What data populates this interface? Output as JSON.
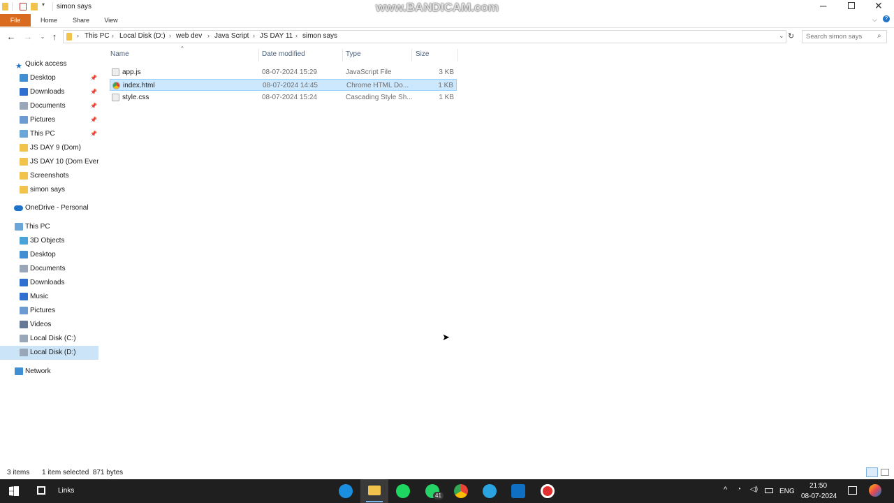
{
  "window": {
    "title": "simon says",
    "watermark": "www.BANDICAM.com"
  },
  "ribbon": {
    "tabs": [
      "File",
      "Home",
      "Share",
      "View"
    ]
  },
  "address_bar": {
    "breadcrumbs": [
      "This PC",
      "Local Disk (D:)",
      "web dev",
      "Java Script",
      "JS DAY 11",
      "simon says"
    ],
    "search_placeholder": "Search simon says"
  },
  "nav_pane": {
    "quick_access": "Quick access",
    "quick_items": [
      {
        "label": "Desktop",
        "icon": "desktop-icon"
      },
      {
        "label": "Downloads",
        "icon": "downloads-icon"
      },
      {
        "label": "Documents",
        "icon": "documents-icon"
      },
      {
        "label": "Pictures",
        "icon": "pictures-icon"
      },
      {
        "label": "This PC",
        "icon": "pc-icon"
      },
      {
        "label": "JS DAY 9 (Dom)",
        "icon": "folder-icon"
      },
      {
        "label": "JS DAY 10 (Dom Event",
        "icon": "folder-icon"
      },
      {
        "label": "Screenshots",
        "icon": "folder-icon"
      },
      {
        "label": "simon says",
        "icon": "folder-icon"
      }
    ],
    "onedrive": "OneDrive - Personal",
    "this_pc": "This PC",
    "pc_items": [
      {
        "label": "3D Objects",
        "icon": "3d-objects-icon"
      },
      {
        "label": "Desktop",
        "icon": "desktop-icon"
      },
      {
        "label": "Documents",
        "icon": "documents-icon"
      },
      {
        "label": "Downloads",
        "icon": "downloads-icon"
      },
      {
        "label": "Music",
        "icon": "music-icon"
      },
      {
        "label": "Pictures",
        "icon": "pictures-icon"
      },
      {
        "label": "Videos",
        "icon": "videos-icon"
      },
      {
        "label": "Local Disk (C:)",
        "icon": "drive-icon"
      },
      {
        "label": "Local Disk (D:)",
        "icon": "drive-icon"
      }
    ],
    "network": "Network"
  },
  "file_list": {
    "columns": [
      "Name",
      "Date modified",
      "Type",
      "Size"
    ],
    "rows": [
      {
        "name": "app.js",
        "date": "08-07-2024 15:29",
        "type": "JavaScript File",
        "size": "3 KB"
      },
      {
        "name": "index.html",
        "date": "08-07-2024 14:45",
        "type": "Chrome HTML Do...",
        "size": "1 KB"
      },
      {
        "name": "style.css",
        "date": "08-07-2024 15:24",
        "type": "Cascading Style Sh...",
        "size": "1 KB"
      }
    ]
  },
  "status_bar": {
    "item_count": "3 items",
    "selection": "1 item selected  871 bytes"
  },
  "taskbar": {
    "links_label": "Links",
    "whatsapp_badge": "41",
    "language": "ENG",
    "time": "21:50",
    "date": "08-07-2024"
  },
  "colors": {
    "selection": "#cce8ff",
    "nav_selection": "#cce4f7",
    "file_tab": "#d86b1f",
    "taskbar": "#1f1f1f"
  }
}
